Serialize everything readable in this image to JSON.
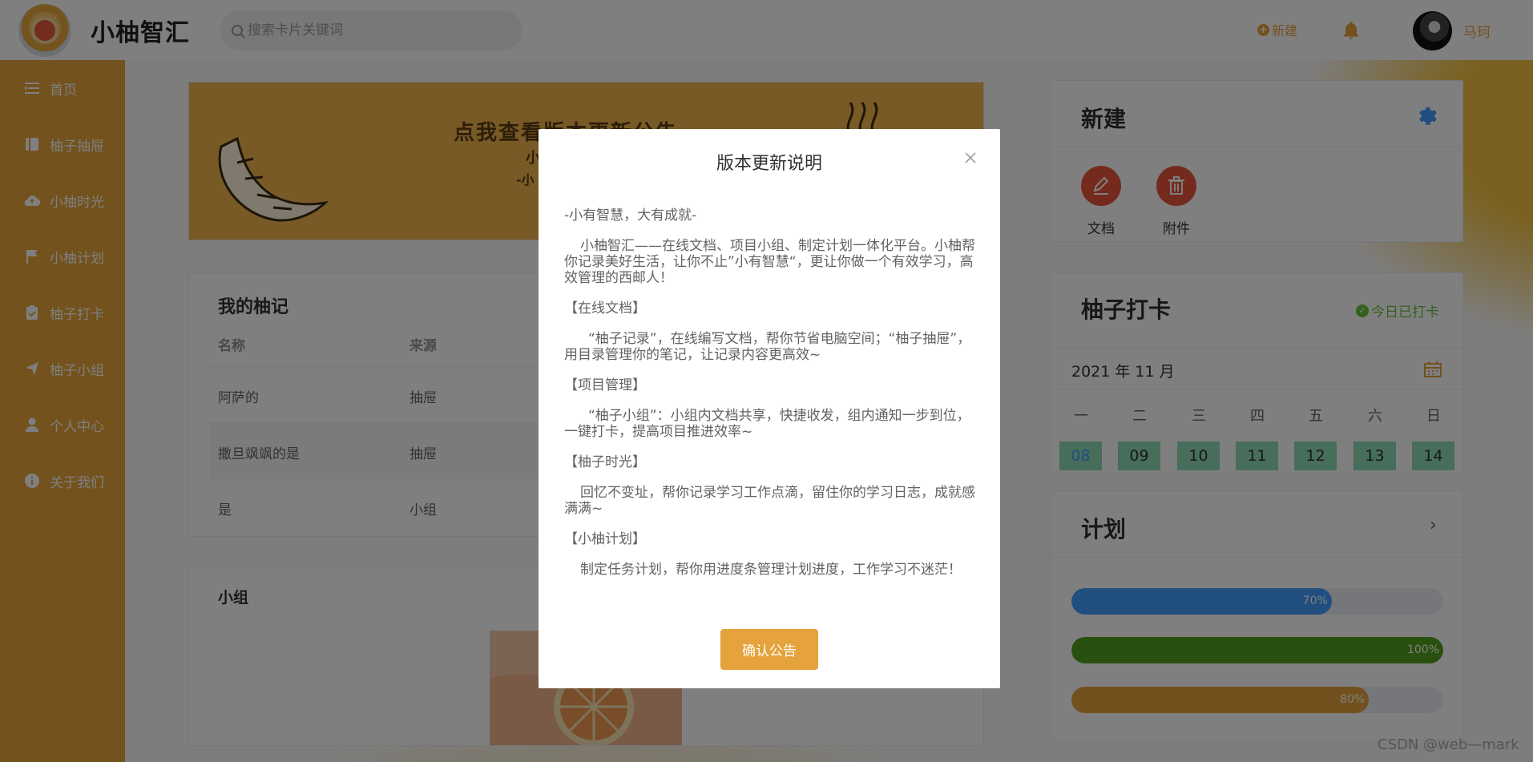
{
  "header": {
    "app_title": "小柚智汇",
    "search_placeholder": "搜索卡片关键词",
    "new_label": "新建",
    "username": "马珂"
  },
  "sidebar": {
    "items": [
      {
        "label": "首页",
        "icon": "menu-icon"
      },
      {
        "label": "柚子抽屉",
        "icon": "book-icon"
      },
      {
        "label": "小柚时光",
        "icon": "cloud-upload-icon"
      },
      {
        "label": "小柚计划",
        "icon": "flag-icon"
      },
      {
        "label": "柚子打卡",
        "icon": "clipboard-icon"
      },
      {
        "label": "柚子小组",
        "icon": "send-icon"
      },
      {
        "label": "个人中心",
        "icon": "user-icon"
      },
      {
        "label": "关于我们",
        "icon": "info-icon"
      }
    ]
  },
  "banner": {
    "title": "点我查看版本更新公告",
    "line1": "小",
    "line2": "-小"
  },
  "notes": {
    "title": "我的柚记",
    "columns": [
      "名称",
      "来源"
    ],
    "rows": [
      {
        "name": "阿萨的",
        "source": "抽屉"
      },
      {
        "name": "撒旦飒飒的是",
        "source": "抽屉"
      },
      {
        "name": "是",
        "source": "小组"
      }
    ]
  },
  "group": {
    "title": "小组"
  },
  "new_card": {
    "title": "新建",
    "actions": [
      {
        "label": "文档",
        "icon": "pencil-icon"
      },
      {
        "label": "附件",
        "icon": "trash-icon"
      }
    ]
  },
  "checkin": {
    "title": "柚子打卡",
    "status": "今日已打卡",
    "month": "2021 年 11 月",
    "weekdays": [
      "一",
      "二",
      "三",
      "四",
      "五",
      "六",
      "日"
    ],
    "days": [
      "08",
      "09",
      "10",
      "11",
      "12",
      "13",
      "14"
    ]
  },
  "plan": {
    "title": "计划",
    "bars": [
      {
        "label": "70%",
        "value": 70,
        "color": "#409eff"
      },
      {
        "label": "100%",
        "value": 100,
        "color": "#52a11f"
      },
      {
        "label": "80%",
        "value": 80,
        "color": "#e6a23c"
      }
    ]
  },
  "dialog": {
    "title": "版本更新说明",
    "slogan": "-小有智慧，大有成就-",
    "intro": "小柚智汇——在线文档、项目小组、制定计划一体化平台。小柚帮你记录美好生活，让你不止”小有智慧“，更让你做一个有效学习，高效管理的西邮人！",
    "sections": [
      {
        "heading": "【在线文档】",
        "text": "“柚子记录”，在线编写文档，帮你节省电脑空间；“柚子抽屉”，用目录管理你的笔记，让记录内容更高效~"
      },
      {
        "heading": "【项目管理】",
        "text": "“柚子小组”：小组内文档共享，快捷收发，组内通知一步到位，一键打卡，提高项目推进效率~"
      },
      {
        "heading": "【柚子时光】",
        "text": "回忆不变址，帮你记录学习工作点滴，留住你的学习日志，成就感满满~"
      },
      {
        "heading": "【小柚计划】",
        "text": "制定任务计划，帮你用进度条管理计划进度，工作学习不迷茫！"
      }
    ],
    "confirm_label": "确认公告"
  },
  "watermark": "CSDN @web—mark",
  "colors": {
    "accent": "#e6a23c",
    "sidebar": "#e7a43b",
    "checkin_green": "#67c23a",
    "action_red": "#e8553a"
  }
}
